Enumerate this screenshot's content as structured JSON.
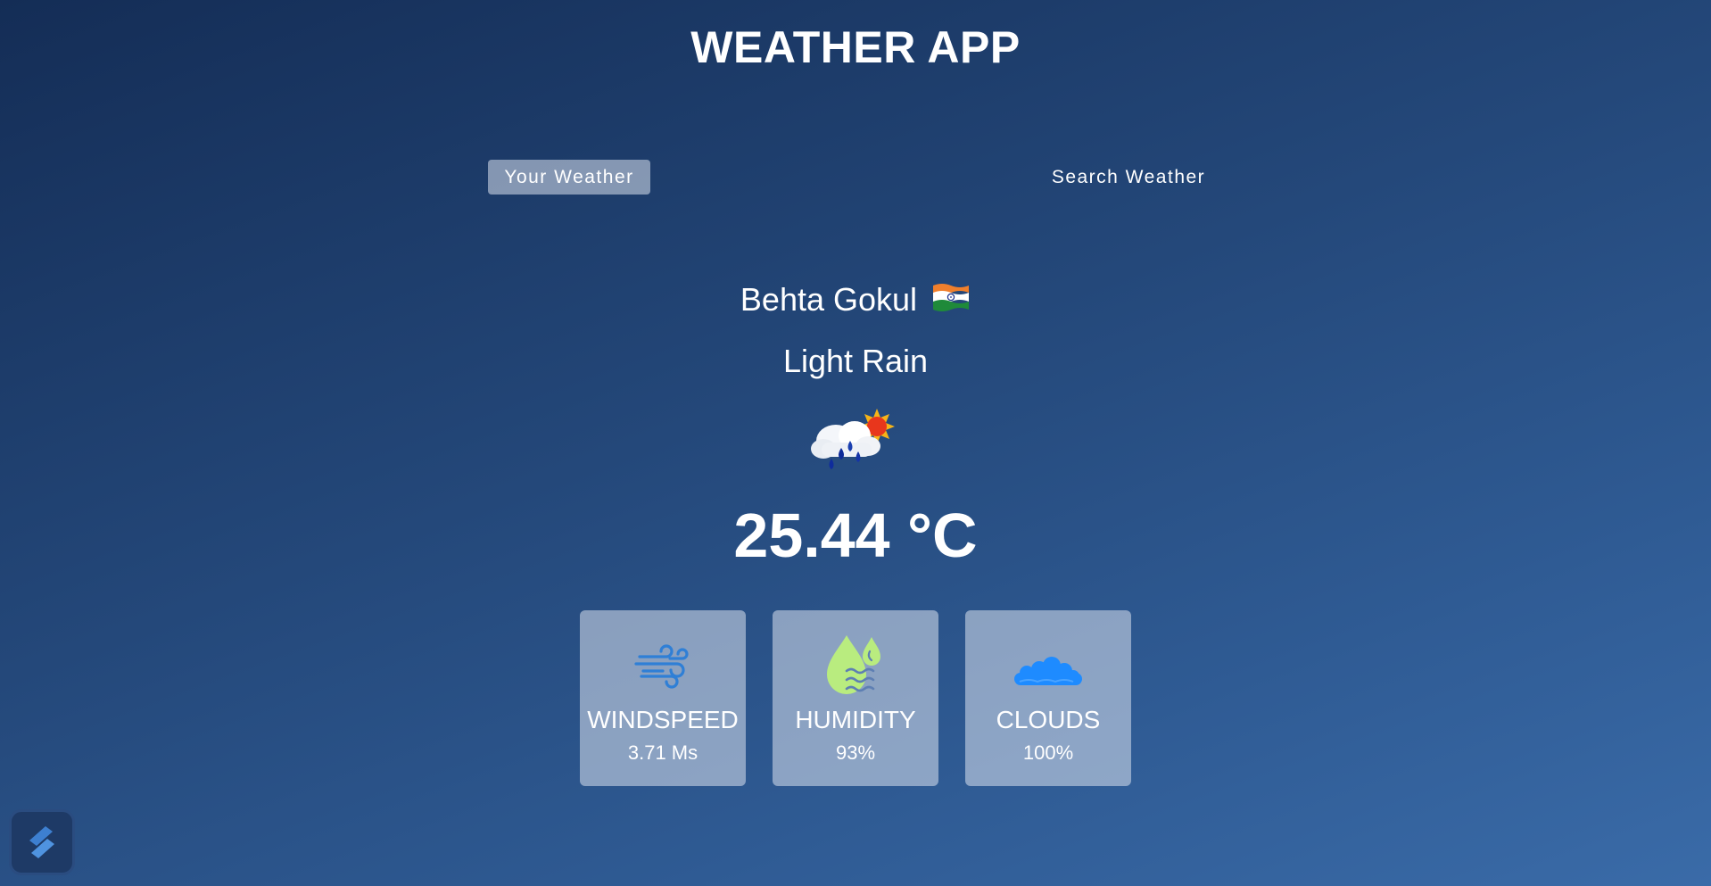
{
  "app": {
    "title": "WEATHER APP"
  },
  "tabs": [
    {
      "label": "Your Weather",
      "active": true
    },
    {
      "label": "Search Weather",
      "active": false
    }
  ],
  "weather": {
    "city": "Behta Gokul",
    "country_flag_icon": "india-flag-icon",
    "description": "Light Rain",
    "condition_icon": "rain-cloud-sun-icon",
    "temperature": "25.44 °C"
  },
  "stats": [
    {
      "label": "WINDSPEED",
      "value": "3.71 Ms",
      "icon": "wind-icon",
      "color": "#2f7fd6"
    },
    {
      "label": "HUMIDITY",
      "value": "93%",
      "icon": "humidity-icon",
      "color": "#b9ec7f"
    },
    {
      "label": "CLOUDS",
      "value": "100%",
      "icon": "cloud-icon",
      "color": "#1e8bff"
    }
  ],
  "colors": {
    "background_top": "#142d56",
    "background_bottom": "#3a6ba8",
    "card_background": "#a6b7d3",
    "text": "#ffffff"
  },
  "corner_badge_icon": "app-logo-icon"
}
